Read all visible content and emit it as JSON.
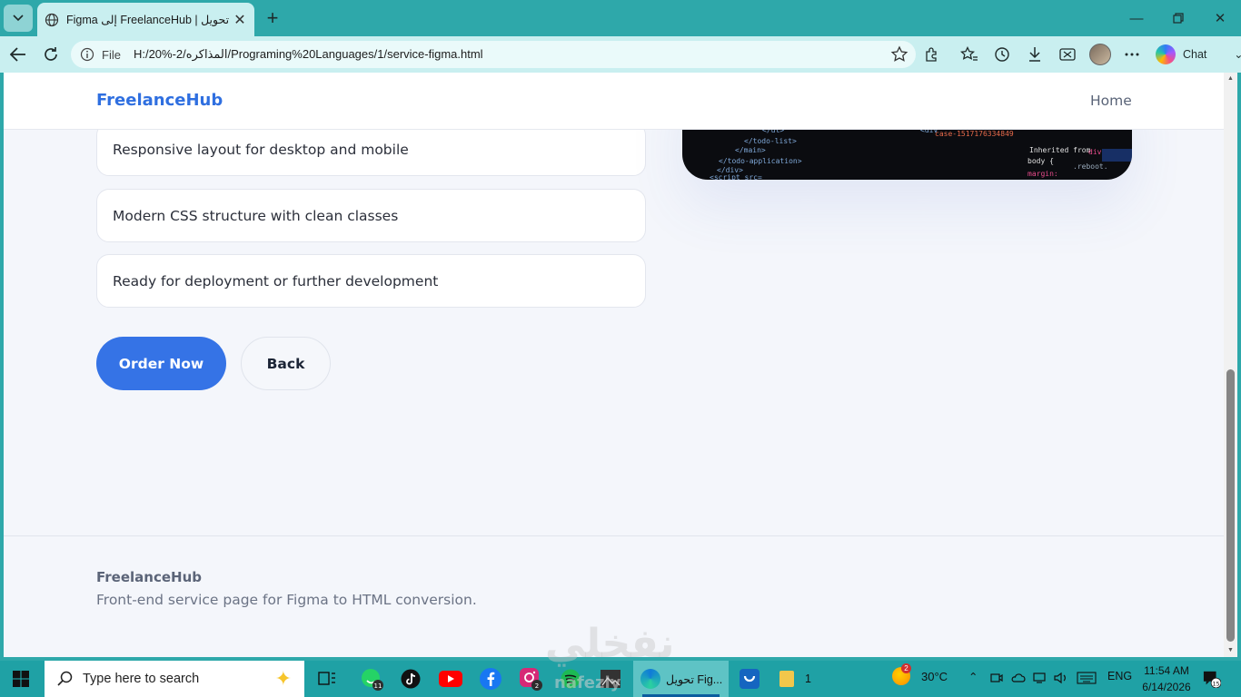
{
  "browser": {
    "tab_title": "Figma إلى FreelanceHub | تحويل",
    "address_label": "File",
    "url": "H:/20%-2/المذاكره/Programing%20Languages/1/service-figma.html",
    "chat_label": "Chat"
  },
  "page": {
    "brand": "FreelanceHub",
    "nav_home": "Home",
    "features": [
      "Responsive layout for desktop and mobile",
      "Modern CSS structure with clean classes",
      "Ready for deployment or further development"
    ],
    "order_button": "Order Now",
    "back_button": "Back",
    "footer_brand": "FreelanceHub",
    "footer_text": "Front-end service page for Figma to HTML conversion."
  },
  "watermark": {
    "text": "نفخلي",
    "sub": "nafezly"
  },
  "taskbar": {
    "search_placeholder": "Type here to search",
    "whatsapp_badge": "11",
    "instagram_badge": "2",
    "edge_label": "تحويل Fig...",
    "files_label": "1",
    "weather_temp": "30°C",
    "weather_badge": "2",
    "language": "ENG",
    "time": "11:54 AM",
    "date": "6/14/2026",
    "notifications": "15"
  },
  "colors": {
    "accent": "#3573e6",
    "brand": "#2f6fe0",
    "chrome": "#2ea8aa",
    "chrome_light": "#c9eff0"
  }
}
